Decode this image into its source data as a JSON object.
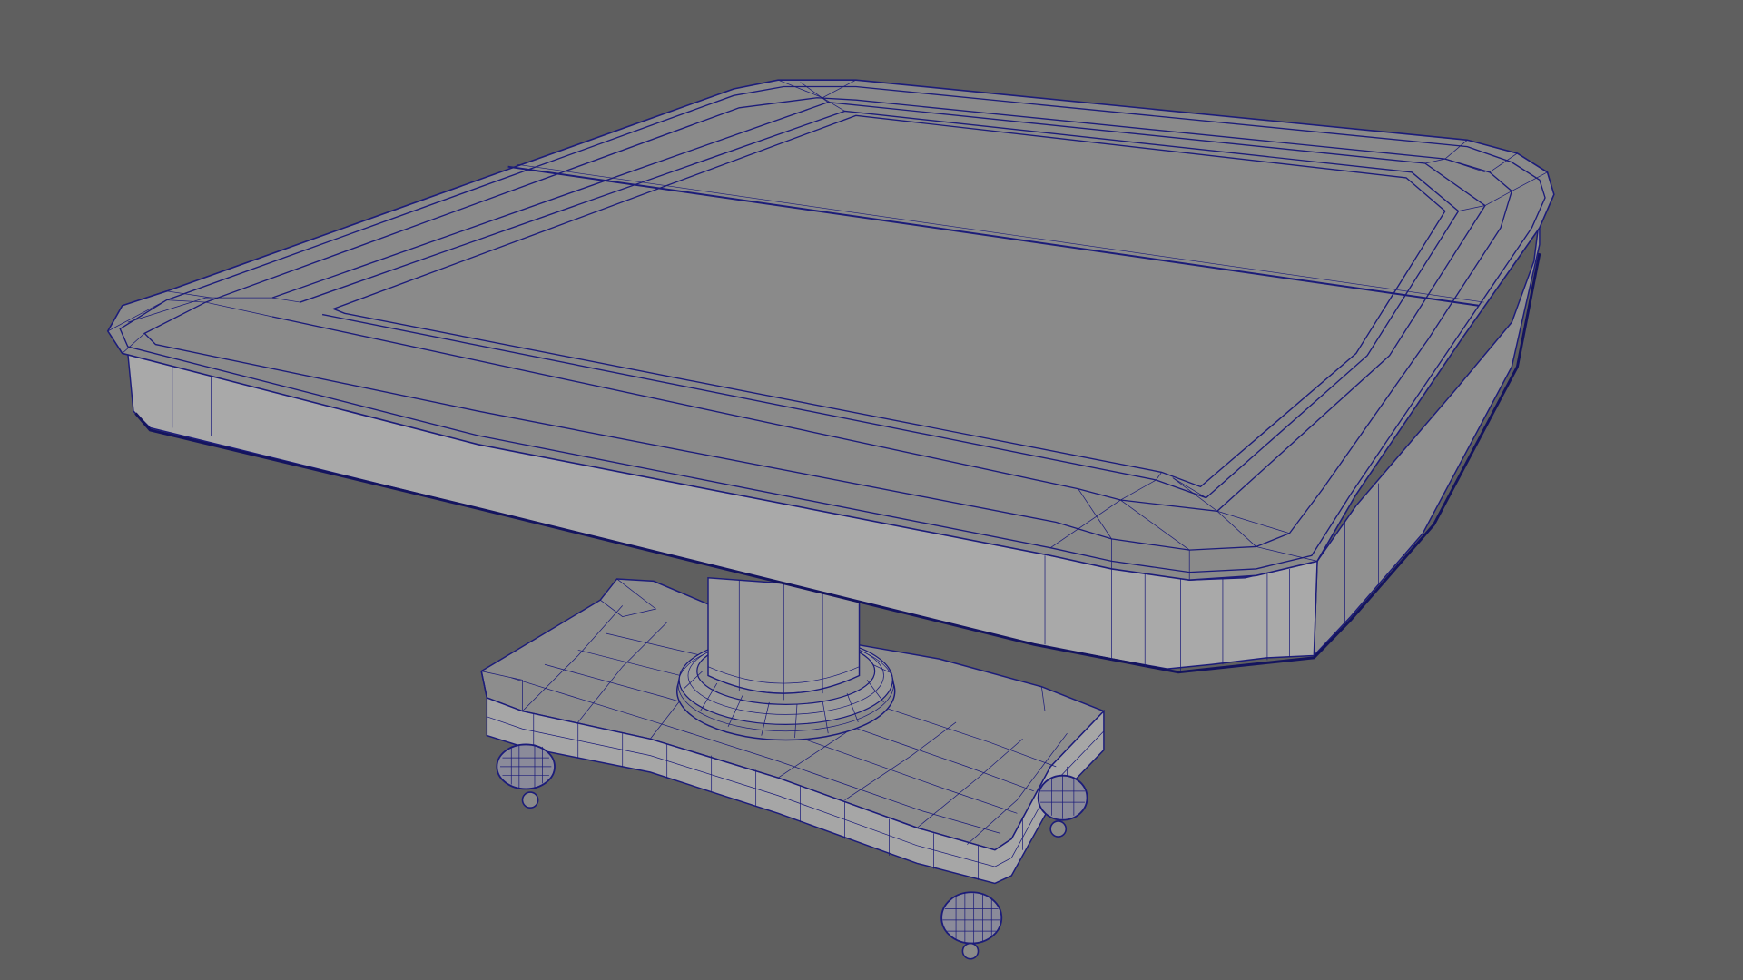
{
  "viewport": {
    "background_color": "#5f5f5f",
    "wireframe_color": "#1c1c7a",
    "surface_color": "#8a8a8a",
    "model": "pedestal-table-wireframe"
  }
}
